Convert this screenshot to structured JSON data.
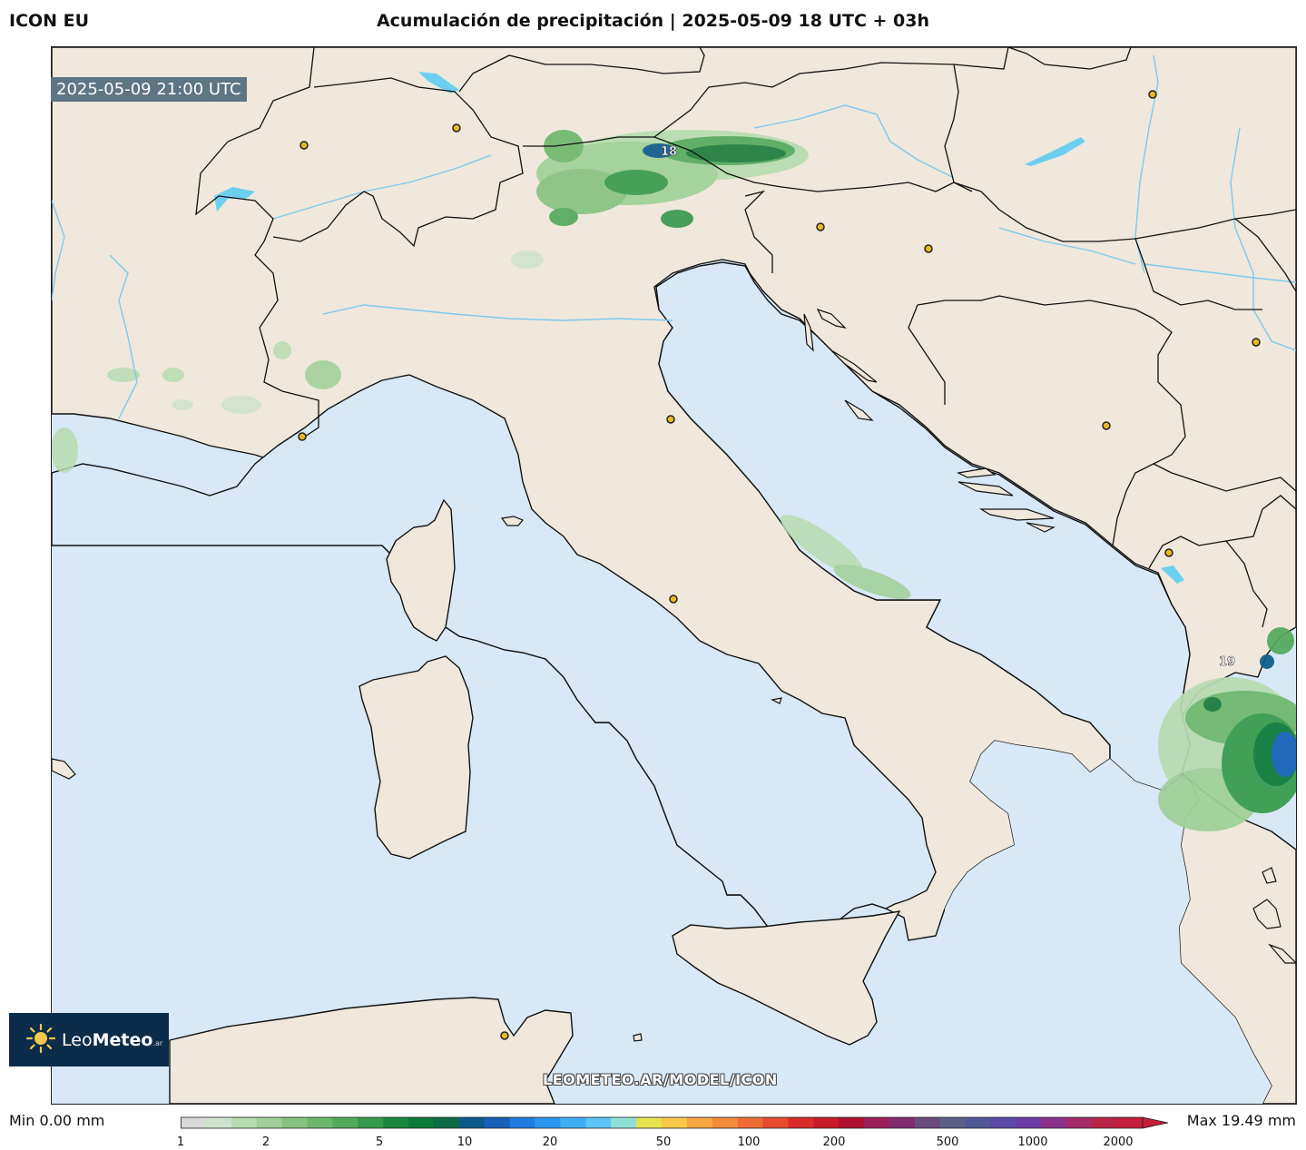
{
  "header": {
    "model": "ICON EU",
    "title": "Acumulación de precipitación | 2025-05-09 18 UTC + 03h"
  },
  "map": {
    "valid_time": "2025-05-09 21:00 UTC",
    "watermark": "LEOMETEO.AR/MODEL/ICON",
    "cell_labels": [
      "18",
      "19"
    ],
    "colors": {
      "sea": "#d8e8f7",
      "land": "#f0e8dc",
      "border": "#111111",
      "river": "#7fc9ef",
      "lake": "#6dcff0",
      "city_marker": "#e8b923",
      "precip_light": "#b7dcb0",
      "precip_medium": "#5cae6a",
      "precip_heavy": "#1a7a3a",
      "precip_very_heavy": "#1e4fa8"
    }
  },
  "logo": {
    "brand_light": "Leo",
    "brand_bold": "Meteo",
    "suffix": ".ar",
    "icon": "sun-icon"
  },
  "colorbar": {
    "min_label": "Min 0.00 mm",
    "max_label": "Max 19.49 mm",
    "ticks": [
      "1",
      "2",
      "5",
      "10",
      "20",
      "50",
      "100",
      "200",
      "500",
      "1000",
      "2000"
    ],
    "colors": [
      "#d9d9d9",
      "#cfe3cc",
      "#b7dcb0",
      "#9fd097",
      "#86c27f",
      "#6db76a",
      "#52a95a",
      "#35994b",
      "#1a883e",
      "#0a7a38",
      "#0d6b46",
      "#0c5a8a",
      "#1560b8",
      "#1e7be0",
      "#2b96f0",
      "#3eaef4",
      "#5cc4f5",
      "#8fe0d6",
      "#e7e34f",
      "#f8c94a",
      "#f7a642",
      "#f28b3a",
      "#ee6b35",
      "#e64a2e",
      "#db2a2a",
      "#c71a2a",
      "#b00f30",
      "#9c1f5a",
      "#7f2d6e",
      "#6a4a7c",
      "#5a5f86",
      "#505896",
      "#5a49a6",
      "#6b3ca6",
      "#8a2f8a",
      "#a52a66",
      "#b82447",
      "#c41e3a"
    ]
  }
}
